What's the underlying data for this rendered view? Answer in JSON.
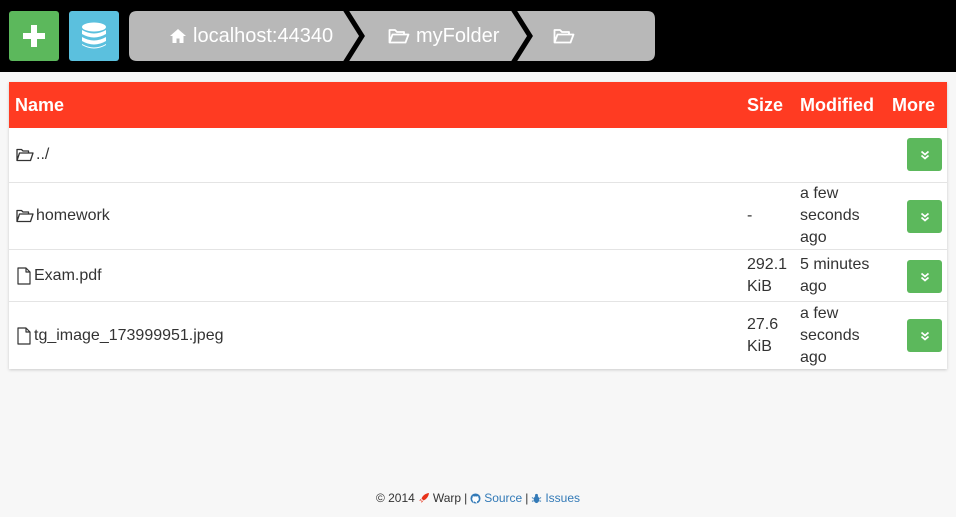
{
  "toolbar": {
    "add_icon": "plus-icon",
    "db_icon": "database-icon",
    "add_color": "#5cb85c",
    "db_color": "#5bc0de"
  },
  "breadcrumb": {
    "items": [
      {
        "icon": "home-icon",
        "label": "localhost:44340"
      },
      {
        "icon": "folder-open-icon",
        "label": "myFolder"
      },
      {
        "icon": "folder-open-icon",
        "label": ""
      }
    ]
  },
  "table": {
    "header_color": "#ff3b22",
    "columns": {
      "name": "Name",
      "size": "Size",
      "modified": "Modified",
      "more": "More"
    },
    "rows": [
      {
        "icon": "folder-open-icon",
        "name": "../",
        "size": "",
        "modified": ""
      },
      {
        "icon": "folder-open-icon",
        "name": "homework",
        "size": "-",
        "modified": "a few seconds ago"
      },
      {
        "icon": "file-icon",
        "name": "Exam.pdf",
        "size": "292.1 KiB",
        "modified": "5 minutes ago"
      },
      {
        "icon": "file-icon",
        "name": "tg_image_173999951.jpeg",
        "size": "27.6 KiB",
        "modified": "a few seconds ago"
      }
    ]
  },
  "footer": {
    "copyright": "© 2014",
    "app": "Warp",
    "sep1": "|",
    "source": "Source",
    "sep2": "|",
    "issues": "Issues"
  }
}
